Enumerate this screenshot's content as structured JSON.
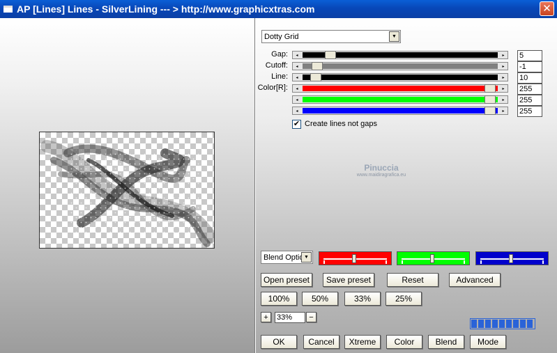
{
  "window": {
    "title": "AP [Lines]  Lines - SilverLining      --- > http://www.graphicxtras.com",
    "close_symbol": "✕"
  },
  "preset_select": {
    "value": "Dotty Grid"
  },
  "sliders": [
    {
      "label": "Gap:",
      "value": "5",
      "color": "#000000",
      "pos": 0.12
    },
    {
      "label": "Cutoff:",
      "value": "-1",
      "color": "#808080",
      "pos": 0.05
    },
    {
      "label": "Line:",
      "value": "10",
      "color": "#000000",
      "pos": 0.04
    },
    {
      "label": "Color[R]:",
      "value": "255",
      "color": "#ff0000",
      "pos": 0.98
    },
    {
      "label": "",
      "value": "255",
      "color": "#00ff00",
      "pos": 0.98
    },
    {
      "label": "",
      "value": "255",
      "color": "#0000ff",
      "pos": 0.98
    }
  ],
  "checkbox": {
    "label": "Create lines not gaps",
    "checked": "✔"
  },
  "watermark": {
    "line1": "Pinuccia",
    "line2": "www.maidiragrafica.eu"
  },
  "blend": {
    "value": "Blend Optio"
  },
  "color_boxes": [
    {
      "color": "#ff0000",
      "pos": 0.5
    },
    {
      "color": "#00ff00",
      "pos": 0.5
    },
    {
      "color": "#0000cc",
      "pos": 0.5
    }
  ],
  "buttons": {
    "open_preset": "Open preset",
    "save_preset": "Save preset",
    "reset": "Reset",
    "advanced": "Advanced",
    "zoom_100": "100%",
    "zoom_50": "50%",
    "zoom_33": "33%",
    "zoom_25": "25%",
    "ok": "OK",
    "cancel": "Cancel",
    "xtreme": "Xtreme",
    "color": "Color",
    "blend": "Blend",
    "mode": "Mode"
  },
  "zoom": {
    "plus": "+",
    "minus": "−",
    "value": "33%"
  },
  "progress": {
    "segments": 9
  }
}
